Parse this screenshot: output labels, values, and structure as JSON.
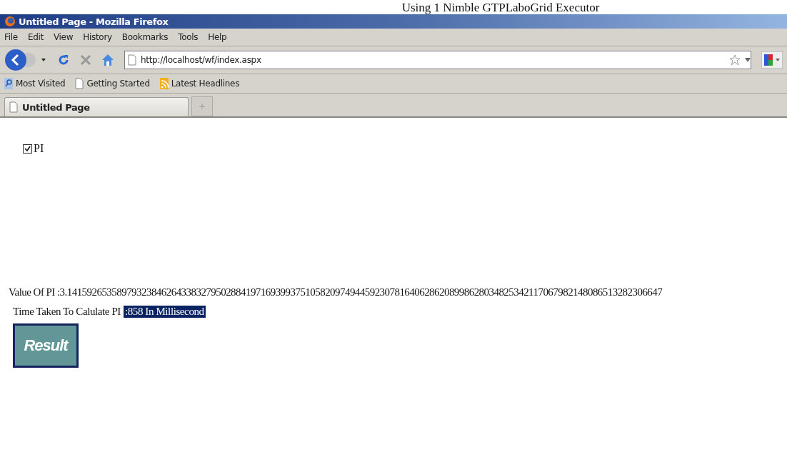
{
  "caption": "Using 1 Nimble GTPLaboGrid Executor",
  "window": {
    "title": "Untitled Page - Mozilla Firefox"
  },
  "menu": [
    "File",
    "Edit",
    "View",
    "History",
    "Bookmarks",
    "Tools",
    "Help"
  ],
  "address": {
    "value": "http://localhost/wf/index.aspx"
  },
  "bookmarks": [
    {
      "label": "Most Visited",
      "kind": "search"
    },
    {
      "label": "Getting Started",
      "kind": "page"
    },
    {
      "label": "Latest Headlines",
      "kind": "feed"
    }
  ],
  "tabs": [
    {
      "label": "Untitled Page",
      "selected": true
    }
  ],
  "page": {
    "checkbox": {
      "label": "PI",
      "checked": true
    },
    "value_label": "Value Of PI :3.141592653589793238462643383279502884197169399375105820974944592307816406286208998628034825342117067982148086513282306647",
    "time_label": "Time Taken To Calulate PI",
    "time_value": ":858 In Millisecond",
    "button": "Result"
  }
}
